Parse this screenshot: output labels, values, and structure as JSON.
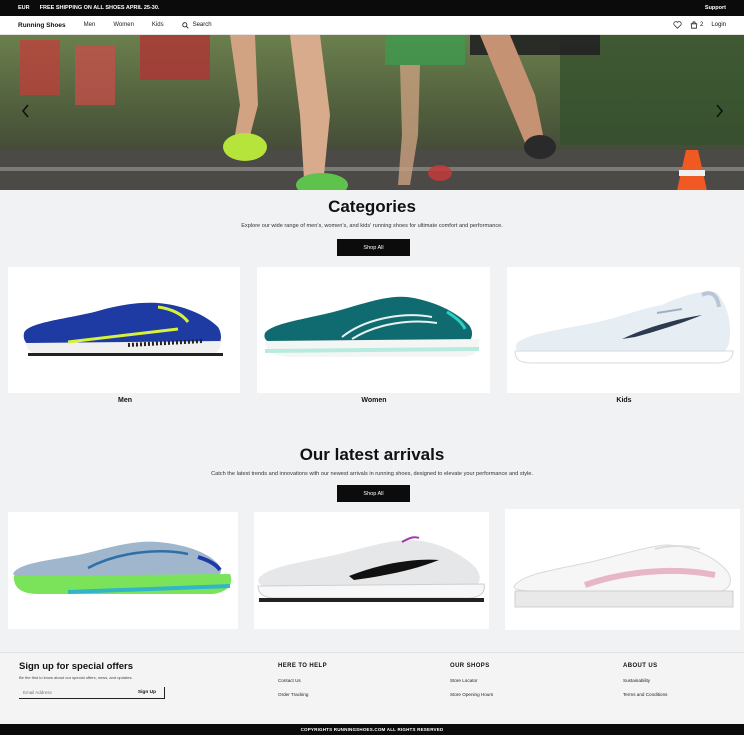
{
  "topbar": {
    "currency": "EUR",
    "promo": "FREE SHIPPING ON ALL SHOES APRIL 25-30.",
    "support": "Support"
  },
  "nav": {
    "brand": "Running Shoes",
    "links": [
      "Men",
      "Women",
      "Kids"
    ],
    "search": "Search",
    "cart_count": "2",
    "login": "Login"
  },
  "categories": {
    "title": "Categories",
    "subtitle": "Explore our wide range of men's, women's, and kids' running shoes for ultimate comfort and performance.",
    "button": "Shop All",
    "items": [
      {
        "label": "Men"
      },
      {
        "label": "Women"
      },
      {
        "label": "Kids"
      }
    ]
  },
  "arrivals": {
    "title": "Our latest arrivals",
    "subtitle": "Catch the latest trends and innovations with our newest arrivals in running shoes, designed to elevate your performance and style.",
    "button": "Shop All"
  },
  "footer": {
    "signup_title": "Sign up for special offers",
    "signup_text": "Be the first to know about our special offers, news, and updates.",
    "email_placeholder": "Email Address",
    "signup_button": "Sign Up",
    "columns": [
      {
        "heading": "HERE TO HELP",
        "links": [
          "Contact Us",
          "Order Tracking"
        ]
      },
      {
        "heading": "OUR SHOPS",
        "links": [
          "Store Locator",
          "Store Opening Hours"
        ]
      },
      {
        "heading": "ABOUT US",
        "links": [
          "Sustainability",
          "Terms and Conditions"
        ]
      }
    ],
    "copyright": "COPYRIGHTS RUNNINGSHOES.COM ALL RIGHTS RESERVED"
  },
  "colors": {
    "accent": "#0b0b0b",
    "page_bg": "#f1f2f4"
  },
  "icons": [
    "chevron-left-icon",
    "chevron-right-icon",
    "search-icon",
    "heart-icon",
    "bag-icon"
  ]
}
